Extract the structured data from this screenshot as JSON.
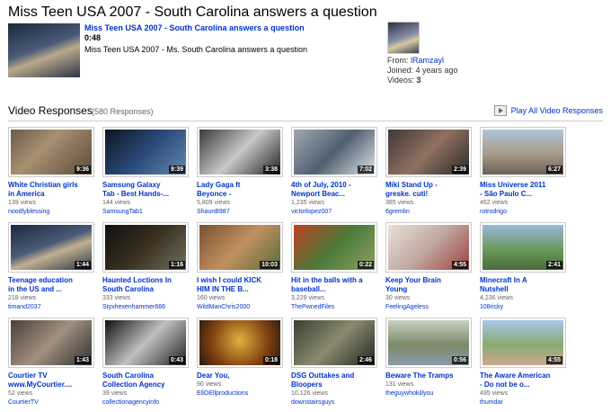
{
  "page_title": "Miss Teen USA 2007 - South Carolina answers a question",
  "original": {
    "link": "Miss Teen USA 2007 - South Carolina answers a question",
    "duration": "0:48",
    "description": "Miss Teen USA 2007 - Ms. South Carolina answers a question"
  },
  "uploader": {
    "from_label": "From: ",
    "name": "lRamzayl",
    "joined": "Joined: 4 years ago",
    "videos_label": "Videos: ",
    "videos_count": "3"
  },
  "responses": {
    "title": "Video Responses",
    "count": "(580 Responses)",
    "play_all": "Play All Video Responses"
  },
  "colors": {
    "link": "#0033cc",
    "divider": "#cccccc"
  },
  "videos": [
    {
      "title_l1": "White Christian girls",
      "title_l2": "in America",
      "views": "139 views",
      "user": "noodlyblessing",
      "duration": "9:36",
      "bg": "linear-gradient(135deg,#6b5a4a,#a89070 40%,#5b4a3a)"
    },
    {
      "title_l1": "Samsung Galaxy",
      "title_l2": "Tab - Best Hands-...",
      "views": "144 views",
      "user": "SamsungTab1",
      "duration": "9:39",
      "bg": "linear-gradient(135deg,#0d1520,#2a4a7a 50%,#6688aa)"
    },
    {
      "title_l1": "Lady Gaga ft",
      "title_l2": "Beyonce -",
      "views": "5,809 views",
      "user": "ShaunB987",
      "duration": "3:38",
      "bg": "linear-gradient(135deg,#3a3a3a,#c8c8c8 50%,#222)"
    },
    {
      "title_l1": "4th of July, 2010 -",
      "title_l2": "Newport Beac...",
      "views": "1,235 views",
      "user": "victorlopez007",
      "duration": "7:02",
      "bg": "linear-gradient(135deg,#a0a8b0,#506070 50%,#e0e4e8)"
    },
    {
      "title_l1": "Miki Stand Up -",
      "title_l2": "greske. cuti!",
      "views": "385 views",
      "user": "6gremlin",
      "duration": "2:39",
      "bg": "linear-gradient(135deg,#403838,#907060 50%,#2a2a2a)"
    },
    {
      "title_l1": "Miss Universe 2011",
      "title_l2": "- São Paulo C...",
      "views": "462 views",
      "user": "rotrodrigo",
      "duration": "6:27",
      "bg": "linear-gradient(180deg,#b0c4d8,#a89a88 55%,#6a6058)"
    },
    {
      "title_l1": "Teenage education",
      "title_l2": "in the US and ...",
      "views": "218 views",
      "user": "timand2037",
      "duration": "1:44",
      "bg": "linear-gradient(160deg,#1c2a3c,#4a5a78 45%,#c0b090 60%,#2a3346)"
    },
    {
      "title_l1": "Haunted Loctions In",
      "title_l2": "South Carolina",
      "views": "333 views",
      "user": "Styxhexenhammer666",
      "duration": "1:16",
      "bg": "linear-gradient(135deg,#101010,#3a3020 50%,#707060)"
    },
    {
      "title_l1": "I wish I could KICK",
      "title_l2": "HIM IN THE B...",
      "views": "160 views",
      "user": "WildManChris2000",
      "duration": "10:03",
      "bg": "linear-gradient(135deg,#7a5030,#c09060 50%,#5a6a3a)"
    },
    {
      "title_l1": "Hit in the balls with a",
      "title_l2": "baseball...",
      "views": "3,229 views",
      "user": "ThePwnedFiles",
      "duration": "0:22",
      "bg": "linear-gradient(135deg,#c04020,#4a7a3a 50%,#90a060)"
    },
    {
      "title_l1": "Keep Your Brain",
      "title_l2": "Young",
      "views": "30 views",
      "user": "FeelingAgeless",
      "duration": "4:55",
      "bg": "linear-gradient(135deg,#e8e0d8,#c0a8a0 50%,#a04040)"
    },
    {
      "title_l1": "Minecraft In A",
      "title_l2": "Nutshell",
      "views": "4,236 views",
      "user": "108ricky",
      "duration": "2:41",
      "bg": "linear-gradient(180deg,#98b8e0,#6a9a5a 55%,#4a6a3a)"
    },
    {
      "title_l1": "Courtier TV",
      "title_l2": "www.MyCourtier....",
      "views": "52 views",
      "user": "CourtierTV",
      "duration": "1:43",
      "bg": "linear-gradient(135deg,#4a4038,#a09080 50%,#303030)"
    },
    {
      "title_l1": "South Carolina",
      "title_l2": "Collection Agency",
      "views": "39 views",
      "user": "collectionagencyinfo",
      "duration": "0:43",
      "bg": "linear-gradient(135deg,#101010,#c0c0c0 50%,#202020)"
    },
    {
      "title_l1": "Dear You,",
      "title_l2": "",
      "views": "90 views",
      "user": "EllOEllproductions",
      "duration": "0:18",
      "bg": "radial-gradient(circle at 50% 45%,#e0b040,#804010 60%,#2a1a10)"
    },
    {
      "title_l1": "DSG Outtakes and",
      "title_l2": "Bloopers",
      "views": "10,126 views",
      "user": "downstairsguys",
      "duration": "2:46",
      "bg": "linear-gradient(135deg,#3a4030,#8a8a70 50%,#202820)"
    },
    {
      "title_l1": "Beware The Tramps",
      "title_l2": "",
      "views": "131 views",
      "user": "theguywhokillyou",
      "duration": "0:56",
      "bg": "linear-gradient(180deg,#c8d0c0,#7a8a6a 55%,#8a9aa8)"
    },
    {
      "title_l1": "The Aware American",
      "title_l2": "- Do not be o...",
      "views": "495 views",
      "user": "thumdar",
      "duration": "4:55",
      "bg": "linear-gradient(180deg,#a8c8e8,#88aa70 55%,#d0a890)"
    }
  ]
}
